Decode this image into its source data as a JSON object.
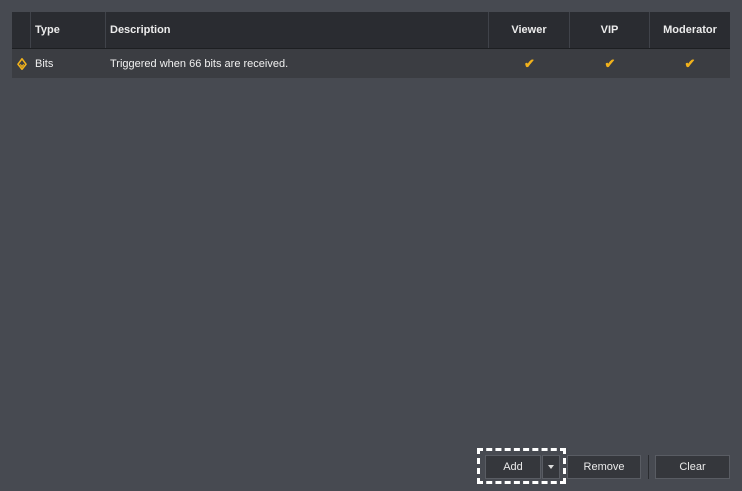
{
  "table": {
    "headers": {
      "type": "Type",
      "description": "Description",
      "viewer": "Viewer",
      "vip": "VIP",
      "moderator": "Moderator"
    },
    "rows": [
      {
        "icon": "bits-diamond-icon",
        "type": "Bits",
        "description": "Triggered when 66 bits are received.",
        "viewer": "✔",
        "vip": "✔",
        "moderator": "✔"
      }
    ]
  },
  "buttons": {
    "add": "Add",
    "remove": "Remove",
    "clear": "Clear"
  },
  "colors": {
    "background": "#474a51",
    "header": "#2a2c31",
    "row": "#3b3d42",
    "accent": "#f2b21b"
  }
}
